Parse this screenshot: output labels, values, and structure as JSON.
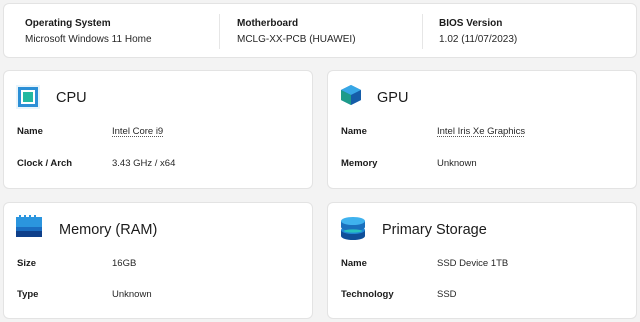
{
  "summary": {
    "os": {
      "label": "Operating System",
      "value": "Microsoft Windows 11 Home"
    },
    "motherboard": {
      "label": "Motherboard",
      "value": "MCLG-XX-PCB (HUAWEI)"
    },
    "bios": {
      "label": "BIOS Version",
      "value": "1.02 (11/07/2023)"
    }
  },
  "cpu": {
    "title": "CPU",
    "icon": "cpu-icon",
    "rows": [
      {
        "label": "Name",
        "value": "Intel Core i9"
      },
      {
        "label": "Clock / Arch",
        "value": "3.43 GHz / x64"
      }
    ]
  },
  "gpu": {
    "title": "GPU",
    "icon": "gpu-icon",
    "rows": [
      {
        "label": "Name",
        "value": "Intel Iris Xe Graphics"
      },
      {
        "label": "Memory",
        "value": "Unknown"
      }
    ]
  },
  "memory": {
    "title": "Memory (RAM)",
    "icon": "memory-icon",
    "rows": [
      {
        "label": "Size",
        "value": "16GB"
      },
      {
        "label": "Type",
        "value": "Unknown"
      }
    ]
  },
  "storage": {
    "title": "Primary Storage",
    "icon": "storage-icon",
    "rows": [
      {
        "label": "Name",
        "value": "SSD Device 1TB"
      },
      {
        "label": "Technology",
        "value": "SSD"
      }
    ]
  }
}
